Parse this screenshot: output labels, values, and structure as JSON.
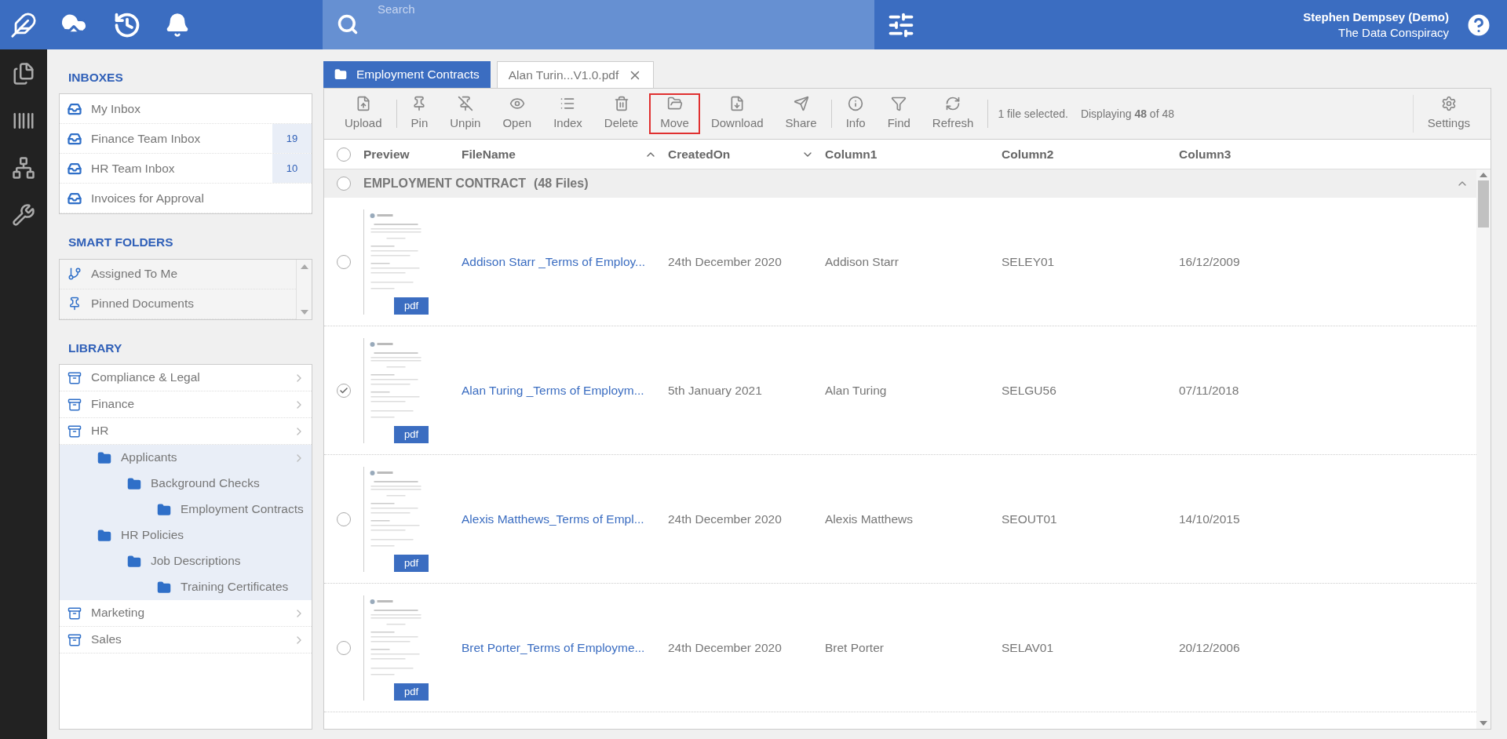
{
  "header": {
    "search": {
      "placeholder": "Search"
    },
    "user": {
      "name": "Stephen Dempsey (Demo)",
      "organization": "The Data Conspiracy"
    }
  },
  "sidebar": {
    "inboxes": {
      "title": "INBOXES",
      "items": [
        {
          "label": "My Inbox"
        },
        {
          "label": "Finance Team Inbox",
          "count": "19"
        },
        {
          "label": "HR Team Inbox",
          "count": "10"
        },
        {
          "label": "Invoices for Approval"
        }
      ]
    },
    "smart_folders": {
      "title": "SMART FOLDERS",
      "items": [
        {
          "label": "Assigned To Me",
          "kind": "assigned"
        },
        {
          "label": "Pinned Documents",
          "kind": "pinned"
        }
      ]
    },
    "library": {
      "title": "LIBRARY",
      "items": [
        {
          "label": "Compliance & Legal",
          "kind": "cabinet",
          "has_arrow": true
        },
        {
          "label": "Finance",
          "kind": "cabinet",
          "has_arrow": true
        },
        {
          "label": "HR",
          "kind": "cabinet",
          "has_arrow": true,
          "children": [
            {
              "label": "Applicants",
              "kind": "folder",
              "has_arrow": true,
              "children": [
                {
                  "label": "Background Checks",
                  "kind": "folder",
                  "has_arrow": false,
                  "children": [
                    {
                      "label": "Employment Contracts",
                      "kind": "folder",
                      "has_arrow": false
                    }
                  ]
                }
              ]
            },
            {
              "label": "HR Policies",
              "kind": "folder",
              "has_arrow": false,
              "children": [
                {
                  "label": "Job Descriptions",
                  "kind": "folder",
                  "has_arrow": false,
                  "children": [
                    {
                      "label": "Training Certificates",
                      "kind": "folder",
                      "has_arrow": false
                    }
                  ]
                }
              ]
            }
          ]
        },
        {
          "label": "Marketing",
          "kind": "cabinet",
          "has_arrow": true
        },
        {
          "label": "Sales",
          "kind": "cabinet",
          "has_arrow": true
        }
      ]
    }
  },
  "tabs": [
    {
      "label": "Employment Contracts",
      "kind": "folder",
      "selected": true
    },
    {
      "label": "Alan Turin...V1.0.pdf",
      "kind": "file",
      "selected": false
    }
  ],
  "toolbar": {
    "groups": [
      [
        {
          "label": "Upload",
          "kind": "upload",
          "selected": false
        }
      ],
      [
        {
          "label": "Pin",
          "kind": "pin",
          "selected": false
        },
        {
          "label": "Unpin",
          "kind": "unpin",
          "selected": false
        },
        {
          "label": "Open",
          "kind": "open",
          "selected": false
        },
        {
          "label": "Index",
          "kind": "index",
          "selected": false
        },
        {
          "label": "Delete",
          "kind": "delete",
          "selected": false
        },
        {
          "label": "Move",
          "kind": "move",
          "selected": true
        },
        {
          "label": "Download",
          "kind": "download",
          "selected": false
        },
        {
          "label": "Share",
          "kind": "share",
          "selected": false
        }
      ],
      [
        {
          "label": "Info",
          "kind": "info",
          "selected": false
        },
        {
          "label": "Find",
          "kind": "find",
          "selected": false
        },
        {
          "label": "Refresh",
          "kind": "refresh",
          "selected": false
        }
      ]
    ],
    "selection_status": "1 file selected.",
    "display_status": "Displaying **48** of 48",
    "settings": {
      "label": "Settings",
      "kind": "settings",
      "selected": false
    }
  },
  "table": {
    "select_all": {
      "checked": false
    },
    "columns": [
      {
        "label": "Preview"
      },
      {
        "label": "FileName",
        "sort_ascending": true
      },
      {
        "label": "CreatedOn",
        "sort_ascending": false
      },
      {
        "label": "Column1"
      },
      {
        "label": "Column2"
      },
      {
        "label": "Column3"
      }
    ],
    "group": {
      "label": "EMPLOYMENT CONTRACT",
      "count": "(48 Files)",
      "checked": false
    },
    "rows": [
      {
        "selected": false,
        "file_type": "pdf",
        "file_name": "Addison Starr _Terms of Employ...",
        "created_on": "24th December 2020",
        "column1": "Addison Starr",
        "column2": "SELEY01",
        "column3": "16/12/2009"
      },
      {
        "selected": true,
        "file_type": "pdf",
        "file_name": "Alan Turing _Terms of Employm...",
        "created_on": "5th January 2021",
        "column1": "Alan Turing",
        "column2": "SELGU56",
        "column3": "07/11/2018"
      },
      {
        "selected": false,
        "file_type": "pdf",
        "file_name": "Alexis Matthews_Terms of Empl...",
        "created_on": "24th December 2020",
        "column1": "Alexis Matthews",
        "column2": "SEOUT01",
        "column3": "14/10/2015"
      },
      {
        "selected": false,
        "file_type": "pdf",
        "file_name": "Bret Porter_Terms of Employme...",
        "created_on": "24th December 2020",
        "column1": "Bret Porter",
        "column2": "SELAV01",
        "column3": "20/12/2006"
      }
    ]
  }
}
